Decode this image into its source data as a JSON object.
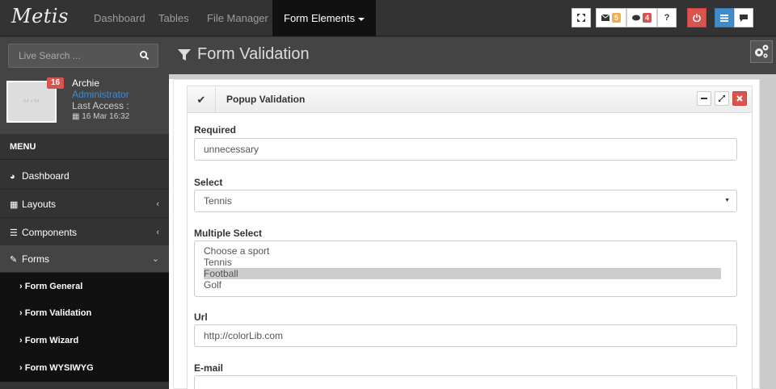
{
  "brand": "Metis",
  "nav": {
    "items": [
      "Dashboard",
      "Tables",
      "File Manager"
    ],
    "active": "Form Elements"
  },
  "toolbar": {
    "messages_count": "5",
    "comments_count": "4",
    "help": "?"
  },
  "search": {
    "placeholder": "Live Search ..."
  },
  "page_title": "Form Validation",
  "user": {
    "badge": "16",
    "avatar_text": "64 x 64",
    "name": "Archie",
    "role": "Administrator",
    "last_access_label": "Last Access :",
    "last_access_date": "16 Mar 16:32"
  },
  "menu": {
    "header": "MENU",
    "items": [
      {
        "label": "Dashboard",
        "icon": "dashboard-icon"
      },
      {
        "label": "Layouts",
        "icon": "layouts-icon"
      },
      {
        "label": "Components",
        "icon": "components-icon"
      },
      {
        "label": "Forms",
        "icon": "pencil-icon"
      }
    ],
    "sub_items": [
      "Form General",
      "Form Validation",
      "Form Wizard",
      "Form WYSIWYG"
    ]
  },
  "box": {
    "title": "Popup Validation"
  },
  "form": {
    "required_label": "Required",
    "required_value": "unnecessary",
    "select_label": "Select",
    "select_value": "Tennis",
    "multi_label": "Multiple Select",
    "multi_options": [
      "Choose a sport",
      "Tennis",
      "Football",
      "Golf"
    ],
    "multi_selected": "Football",
    "url_label": "Url",
    "url_value": "http://colorLib.com",
    "email_label": "E-mail"
  },
  "colors": {
    "navbar": "#333333",
    "danger": "#d9534f",
    "primary": "#428bca",
    "warning": "#f0ad4e"
  }
}
